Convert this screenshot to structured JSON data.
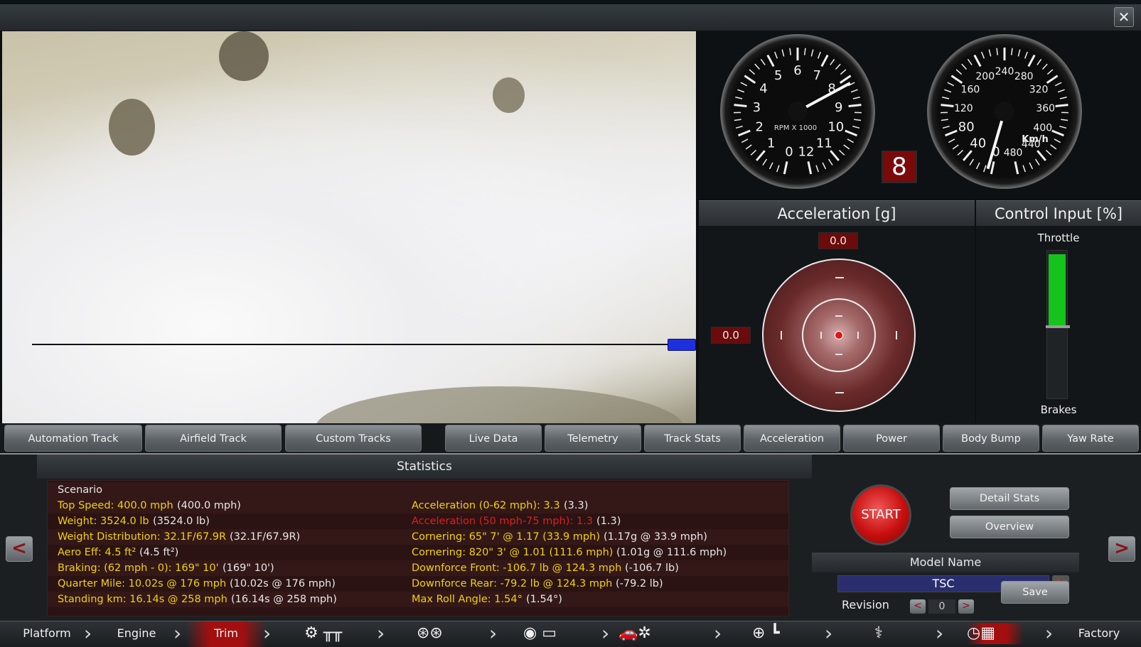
{
  "window": {
    "close_label": "✕"
  },
  "gauges": {
    "rpm": {
      "label": "RPM X 1000",
      "ticks": [
        "0",
        "1",
        "2",
        "3",
        "4",
        "5",
        "6",
        "7",
        "8",
        "9",
        "10",
        "11",
        "12"
      ]
    },
    "speed": {
      "unit": "Km/h",
      "ticks": [
        "0",
        "40",
        "80",
        "120",
        "160",
        "200",
        "240",
        "280",
        "320",
        "360",
        "400",
        "440",
        "480"
      ]
    },
    "gear": "8"
  },
  "acceleration": {
    "title": "Acceleration [g]",
    "longitudinal": "0.0",
    "lateral": "0.0"
  },
  "control_input": {
    "title": "Control Input [%]",
    "throttle_label": "Throttle",
    "brakes_label": "Brakes",
    "throttle_level": 0.47
  },
  "track_tabs": [
    "Automation Track",
    "Airfield Track",
    "Custom Tracks"
  ],
  "data_tabs": [
    "Live Data",
    "Telemetry",
    "Track Stats",
    "Acceleration",
    "Power",
    "Body Bump",
    "Yaw Rate"
  ],
  "statistics": {
    "title": "Statistics",
    "scenario": "Scenario",
    "left": [
      {
        "label": "Top Speed: 400.0 mph",
        "extra": "(400.0 mph)",
        "status": "yl"
      },
      {
        "label": "Weight: 3524.0 lb",
        "extra": "(3524.0 lb)",
        "status": "yl"
      },
      {
        "label": "Weight Distribution: 32.1F/67.9R",
        "extra": "(32.1F/67.9R)",
        "status": "yl"
      },
      {
        "label": "Aero Eff: 4.5 ft²",
        "extra": "(4.5 ft²)",
        "status": "yl"
      },
      {
        "label": "Braking: (62 mph - 0): 169\" 10'",
        "extra": "(169\" 10')",
        "status": "yl"
      },
      {
        "label": "Quarter Mile: 10.02s @ 176 mph",
        "extra": "(10.02s @ 176 mph)",
        "status": "yl"
      },
      {
        "label": "Standing km: 16.14s @ 258 mph",
        "extra": "(16.14s @ 258 mph)",
        "status": "yl"
      }
    ],
    "right": [
      {
        "label": "Acceleration (0-62 mph): 3.3",
        "extra": "(3.3)",
        "status": "yl"
      },
      {
        "label": "Acceleration (50 mph-75 mph): 1.3",
        "extra": "(1.3)",
        "status": "rd"
      },
      {
        "label": "Cornering: 65\" 7' @ 1.17 (33.9 mph)",
        "extra": "(1.17g @ 33.9 mph)",
        "status": "yl"
      },
      {
        "label": "Cornering: 820\" 3' @ 1.01 (111.6 mph)",
        "extra": "(1.01g @ 111.6 mph)",
        "status": "yl"
      },
      {
        "label": "Downforce Front: -106.7 lb @ 124.3 mph",
        "extra": "(-106.7 lb)",
        "status": "yl"
      },
      {
        "label": "Downforce Rear: -79.2 lb @ 124.3 mph",
        "extra": "(-79.2 lb)",
        "status": "yl"
      },
      {
        "label": "Max Roll Angle: 1.54°",
        "extra": "(1.54°)",
        "status": "yl"
      }
    ]
  },
  "controls": {
    "start": "START",
    "detail_stats": "Detail Stats",
    "overview": "Overview",
    "model_name_title": "Model Name",
    "model_name": "TSC",
    "revision_label": "Revision",
    "revision": "0",
    "save": "Save",
    "prev": "<",
    "next": ">"
  },
  "nav": [
    "Platform",
    "Engine",
    "Trim",
    "Factory"
  ],
  "nav_icons": [
    "gearbox-icon",
    "wheels-icon",
    "body-icon",
    "car-aero-icon",
    "interior-icon",
    "testing-icon"
  ],
  "colors": {
    "accent_red": "#a30f0f",
    "stat_yellow": "#f2d20a",
    "stat_red": "#e11d1d",
    "throttle_green": "#16c21c"
  }
}
